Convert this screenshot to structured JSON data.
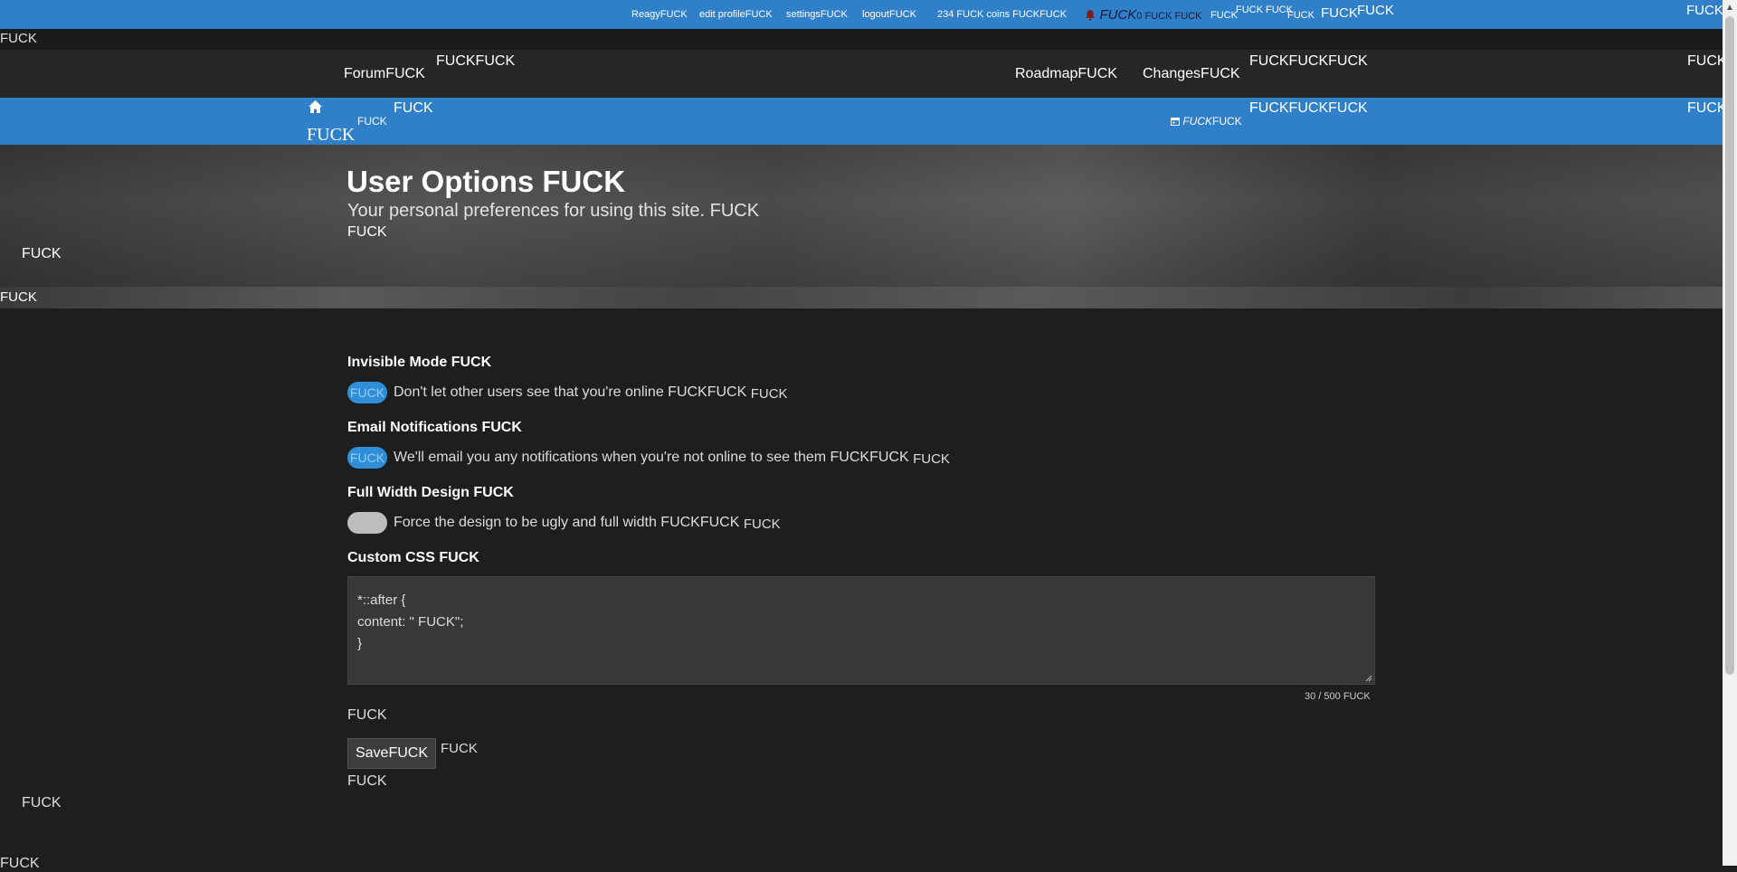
{
  "userbar": {
    "reagy": "ReagyFUCK",
    "edit_profile": "edit profileFUCK",
    "settings": "settingsFUCK",
    "logout": "logoutFUCK",
    "coins": "234 FUCK coins FUCKFUCK",
    "notif_label": "FUCK",
    "notif_count": "0 FUCK FUCK",
    "extra1": "FUCK",
    "extra1_sup": "FUCK FUCK",
    "extra2": "FUCK",
    "extra3": "FUCK",
    "extra3_sup": "FUCK",
    "right_edge": "FUCK"
  },
  "strip1": {
    "text": "FUCK"
  },
  "nav": {
    "forum": "ForumFUCK",
    "forum_sup": "FUCKFUCK",
    "roadmap": "RoadmapFUCK",
    "changes": "ChangesFUCK",
    "right_sup": "FUCKFUCKFUCK",
    "edge": "FUCK"
  },
  "crumbs": {
    "home_sup": "FUCK",
    "home_sup2": "FUCK",
    "home_under": "FUCK",
    "date_icon_text": "FUCK",
    "date_tail": "FUCK",
    "right_sup": "FUCKFUCKFUCK",
    "edge": "FUCK"
  },
  "hero": {
    "title": "User Options FUCK",
    "subtitle": "Your personal preferences for using this site. FUCK",
    "extra": "FUCK",
    "side": "FUCK"
  },
  "hero_strip": {
    "text": "FUCK"
  },
  "options": {
    "invisible": {
      "label": "Invisible Mode FUCK",
      "toggle_text": "FUCK",
      "description": "Don't let other users see that you're online FUCKFUCK",
      "tail": "FUCK",
      "enabled": true
    },
    "email": {
      "label": "Email Notifications FUCK",
      "toggle_text": "FUCK",
      "description": "We'll email you any notifications when you're not online to see them FUCKFUCK",
      "tail": "FUCK",
      "enabled": true
    },
    "fullwidth": {
      "label": "Full Width Design FUCK",
      "toggle_text": "",
      "description": "Force the design to be ugly and full width FUCKFUCK",
      "tail": "FUCK",
      "enabled": false
    },
    "custom_css": {
      "label": "Custom CSS FUCK",
      "value": "*::after {\ncontent: \" FUCK\";\n}",
      "counter": "30 / 500 FUCK"
    }
  },
  "form": {
    "after_css": "FUCK",
    "save_label": "SaveFUCK",
    "after_save": "FUCK",
    "below_save": "FUCK"
  },
  "footer": {
    "side": "FUCK",
    "bottom": "FUCK"
  },
  "colors": {
    "accent": "#2f80c8",
    "toggle_on": "#2f8ed8",
    "background": "#1e1e1e"
  }
}
